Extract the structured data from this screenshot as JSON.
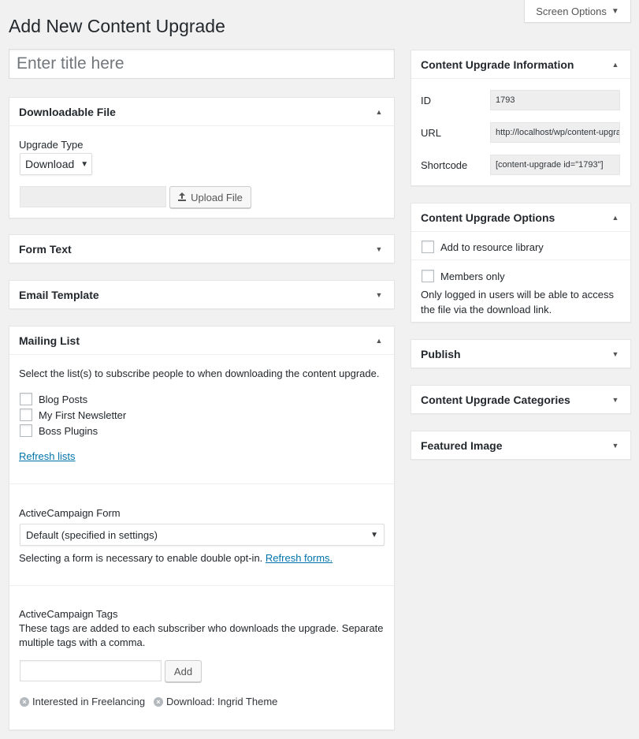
{
  "screen_options": {
    "label": "Screen Options"
  },
  "page": {
    "title": "Add New Content Upgrade",
    "title_placeholder": "Enter title here"
  },
  "downloadable_file": {
    "heading": "Downloadable File",
    "upgrade_type_label": "Upgrade Type",
    "upgrade_type_value": "Download",
    "upload_button": "Upload File",
    "file_value": ""
  },
  "form_text": {
    "heading": "Form Text"
  },
  "email_template": {
    "heading": "Email Template"
  },
  "mailing_list": {
    "heading": "Mailing List",
    "instructions": "Select the list(s) to subscribe people to when downloading the content upgrade.",
    "lists": [
      {
        "label": "Blog Posts",
        "checked": false
      },
      {
        "label": "My First Newsletter",
        "checked": false
      },
      {
        "label": "Boss Plugins",
        "checked": false
      }
    ],
    "refresh_lists": "Refresh lists",
    "ac_form_label": "ActiveCampaign Form",
    "ac_form_value": "Default (specified in settings)",
    "ac_form_help": "Selecting a form is necessary to enable double opt-in.",
    "refresh_forms": "Refresh forms.",
    "ac_tags_label": "ActiveCampaign Tags",
    "ac_tags_help_1": "These tags are added to each subscriber who downloads the upgrade. Separate",
    "ac_tags_help_2": "multiple tags with a comma.",
    "add_button": "Add",
    "tags": [
      "Interested in Freelancing",
      "Download: Ingrid Theme"
    ]
  },
  "info": {
    "heading": "Content Upgrade Information",
    "id_label": "ID",
    "id_value": "1793",
    "url_label": "URL",
    "url_value": "http://localhost/wp/content-upgrade/",
    "shortcode_label": "Shortcode",
    "shortcode_value": "[content-upgrade id=\"1793\"]"
  },
  "options": {
    "heading": "Content Upgrade Options",
    "resource_library": "Add to resource library",
    "members_only": "Members only",
    "members_help_1": "Only logged in users will be able to access",
    "members_help_2": "the file via the download link."
  },
  "publish": {
    "heading": "Publish"
  },
  "categories": {
    "heading": "Content Upgrade Categories"
  },
  "featured_image": {
    "heading": "Featured Image"
  },
  "icons": {
    "expanded": "triangle-up-icon",
    "collapsed": "triangle-down-icon",
    "upload": "upload-icon",
    "remove_tag": "remove-circle-icon"
  },
  "colors": {
    "link": "#0073aa",
    "background": "#f1f1f1"
  }
}
